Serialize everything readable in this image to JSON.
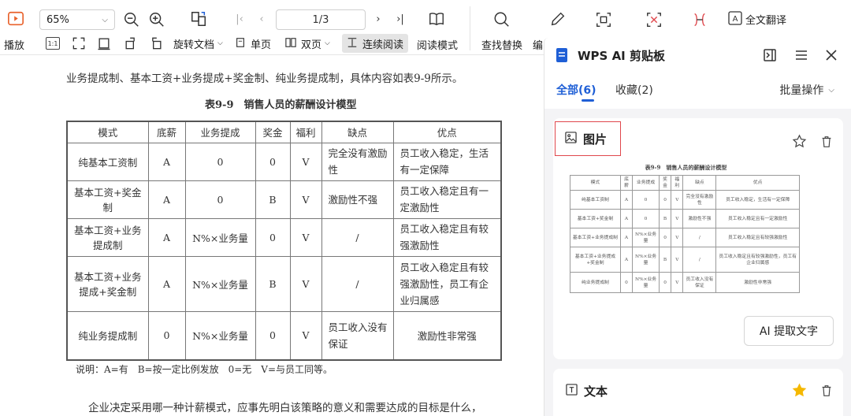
{
  "toolbar": {
    "play_label": "播放",
    "zoom_value": "65%",
    "page_indicator": "1/3",
    "rotate_doc_label": "旋转文档",
    "single_page_label": "单页",
    "double_page_label": "双页",
    "continuous_label": "连续阅读",
    "reading_mode_label": "阅读模式",
    "find_replace_label": "查找替换",
    "edit_label_partial": "编",
    "full_translate_label": "全文翻译",
    "small_fit_label": "1:1"
  },
  "document": {
    "intro_line": "业务提成制、基本工资+业务提成+奖金制、纯业务提成制，具体内容如表9-9所示。",
    "table_caption": "表9-9　销售人员的薪酬设计模型",
    "table": {
      "headers": [
        "模式",
        "底薪",
        "业务提成",
        "奖金",
        "福利",
        "缺点",
        "优点"
      ],
      "rows": [
        [
          "纯基本工资制",
          "A",
          "0",
          "0",
          "V",
          "完全没有激励性",
          "员工收入稳定，生活有一定保障"
        ],
        [
          "基本工资+奖金制",
          "A",
          "0",
          "B",
          "V",
          "激励性不强",
          "员工收入稳定且有一定激励性"
        ],
        [
          "基本工资+业务提成制",
          "A",
          "N%×业务量",
          "0",
          "V",
          "/",
          "员工收入稳定且有较强激励性"
        ],
        [
          "基本工资+业务提成+奖金制",
          "A",
          "N%×业务量",
          "B",
          "V",
          "/",
          "员工收入稳定且有较强激励性，员工有企业归属感"
        ],
        [
          "纯业务提成制",
          "0",
          "N%×业务量",
          "0",
          "V",
          "员工收入没有保证",
          "激励性非常强"
        ]
      ]
    },
    "note": "说明：A=有　B=按一定比例发放　0=无　V=与员工同等。",
    "paragraph": "企业决定采用哪一种计薪模式，应事先明白该策略的意义和需要达成的目标是什么，"
  },
  "panel": {
    "title": "WPS AI 剪贴板",
    "tabs": [
      {
        "label": "全部(6)",
        "active": true
      },
      {
        "label": "收藏(2)",
        "active": false
      }
    ],
    "batch_label": "批量操作",
    "card_image": {
      "label": "图片",
      "ai_button_label": "AI 提取文字",
      "favorited": false
    },
    "card_text": {
      "label": "文本",
      "favorited": true
    }
  },
  "colors": {
    "accent_blue": "#1f5fd6",
    "highlight_red": "#e0474c",
    "star_gold": "#f5b800",
    "play_orange": "#e8622c"
  }
}
